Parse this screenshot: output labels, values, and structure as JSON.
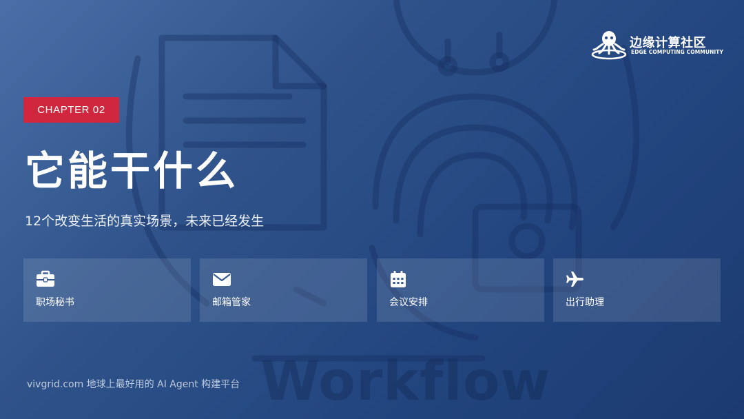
{
  "logo": {
    "name_cn": "边缘计算社区",
    "name_en": "EDGE COMPUTING COMMUNITY",
    "icon": "octopus-logo-icon"
  },
  "chapter": {
    "label": "CHAPTER 02",
    "color": "#d0263e"
  },
  "title": "它能干什么",
  "subtitle": "12个改变生活的真实场景，未来已经发生",
  "cards": [
    {
      "icon": "briefcase-icon",
      "label": "职场秘书"
    },
    {
      "icon": "envelope-icon",
      "label": "邮箱管家"
    },
    {
      "icon": "calendar-icon",
      "label": "会议安排"
    },
    {
      "icon": "airplane-icon",
      "label": "出行助理"
    }
  ],
  "footer": "vivgrid.com 地球上最好用的 AI Agent 构建平台",
  "watermark": "Workflow",
  "colors": {
    "background_start": "#4a6fa8",
    "background_end": "#1b3a70",
    "accent": "#d0263e",
    "text": "#ffffff"
  }
}
